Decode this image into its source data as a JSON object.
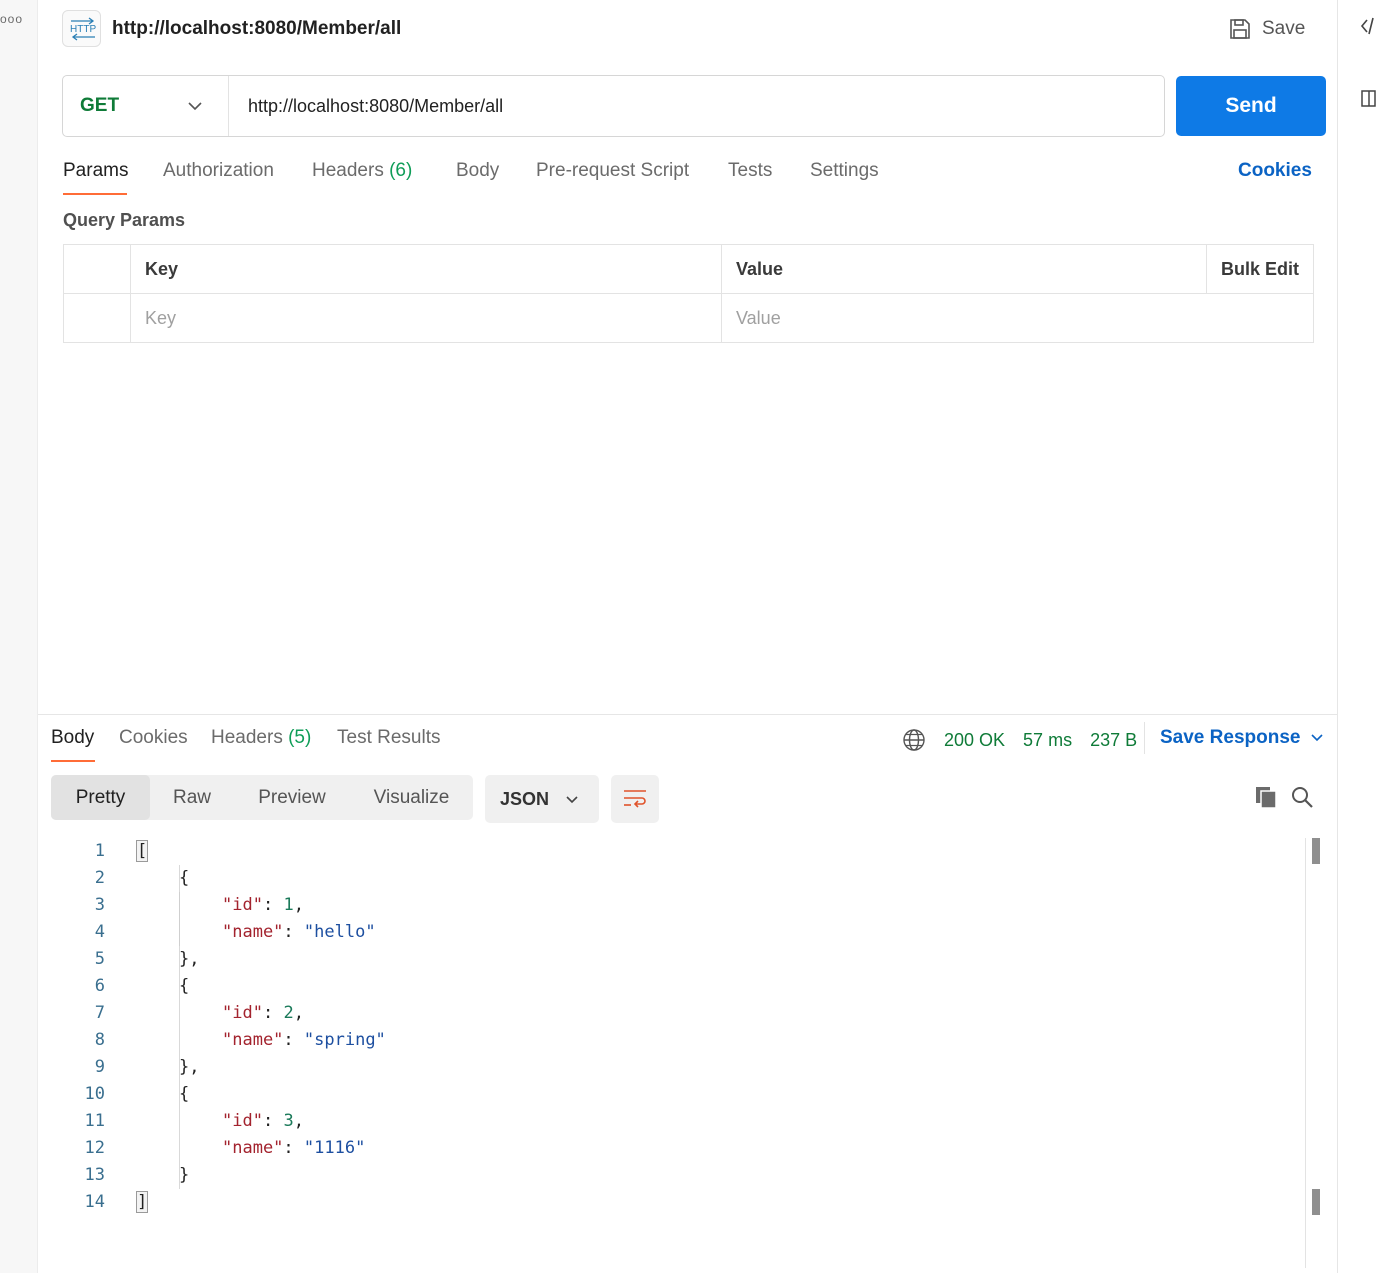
{
  "header": {
    "title": "http://localhost:8080/Member/all",
    "save_label": "Save",
    "badge_text": "HTTP"
  },
  "request": {
    "method": "GET",
    "url": "http://localhost:8080/Member/all",
    "send_label": "Send"
  },
  "request_tabs": [
    {
      "label": "Params",
      "active": true
    },
    {
      "label": "Authorization"
    },
    {
      "label": "Headers",
      "count": "(6)"
    },
    {
      "label": "Body"
    },
    {
      "label": "Pre-request Script"
    },
    {
      "label": "Tests"
    },
    {
      "label": "Settings"
    }
  ],
  "cookies_label": "Cookies",
  "query_params": {
    "title": "Query Params",
    "columns": {
      "key": "Key",
      "value": "Value",
      "bulk_edit": "Bulk Edit"
    },
    "key_placeholder": "Key",
    "value_placeholder": "Value"
  },
  "response": {
    "tabs": [
      {
        "label": "Body",
        "active": true
      },
      {
        "label": "Cookies"
      },
      {
        "label": "Headers",
        "count": "(5)"
      },
      {
        "label": "Test Results"
      }
    ],
    "status": "200 OK",
    "time": "57 ms",
    "size": "237 B",
    "save_response_label": "Save Response",
    "views": [
      "Pretty",
      "Raw",
      "Preview",
      "Visualize"
    ],
    "active_view": "Pretty",
    "format": "JSON"
  },
  "code": {
    "line_numbers": [
      "1",
      "2",
      "3",
      "4",
      "5",
      "6",
      "7",
      "8",
      "9",
      "10",
      "11",
      "12",
      "13",
      "14"
    ],
    "items": [
      {
        "id": "1",
        "name": "\"hello\""
      },
      {
        "id": "2",
        "name": "\"spring\""
      },
      {
        "id": "3",
        "name": "\"1116\""
      }
    ],
    "open_bracket": "[",
    "close_bracket": "]",
    "open_brace": "{",
    "close_brace_comma": "},",
    "close_brace": "}",
    "key_id": "\"id\"",
    "key_name": "\"name\"",
    "colon": ": ",
    "comma": ","
  },
  "colors": {
    "accent": "#ff6c37",
    "send": "#0e7ae6",
    "method_get": "#0f7b38",
    "link": "#0b63c4"
  }
}
